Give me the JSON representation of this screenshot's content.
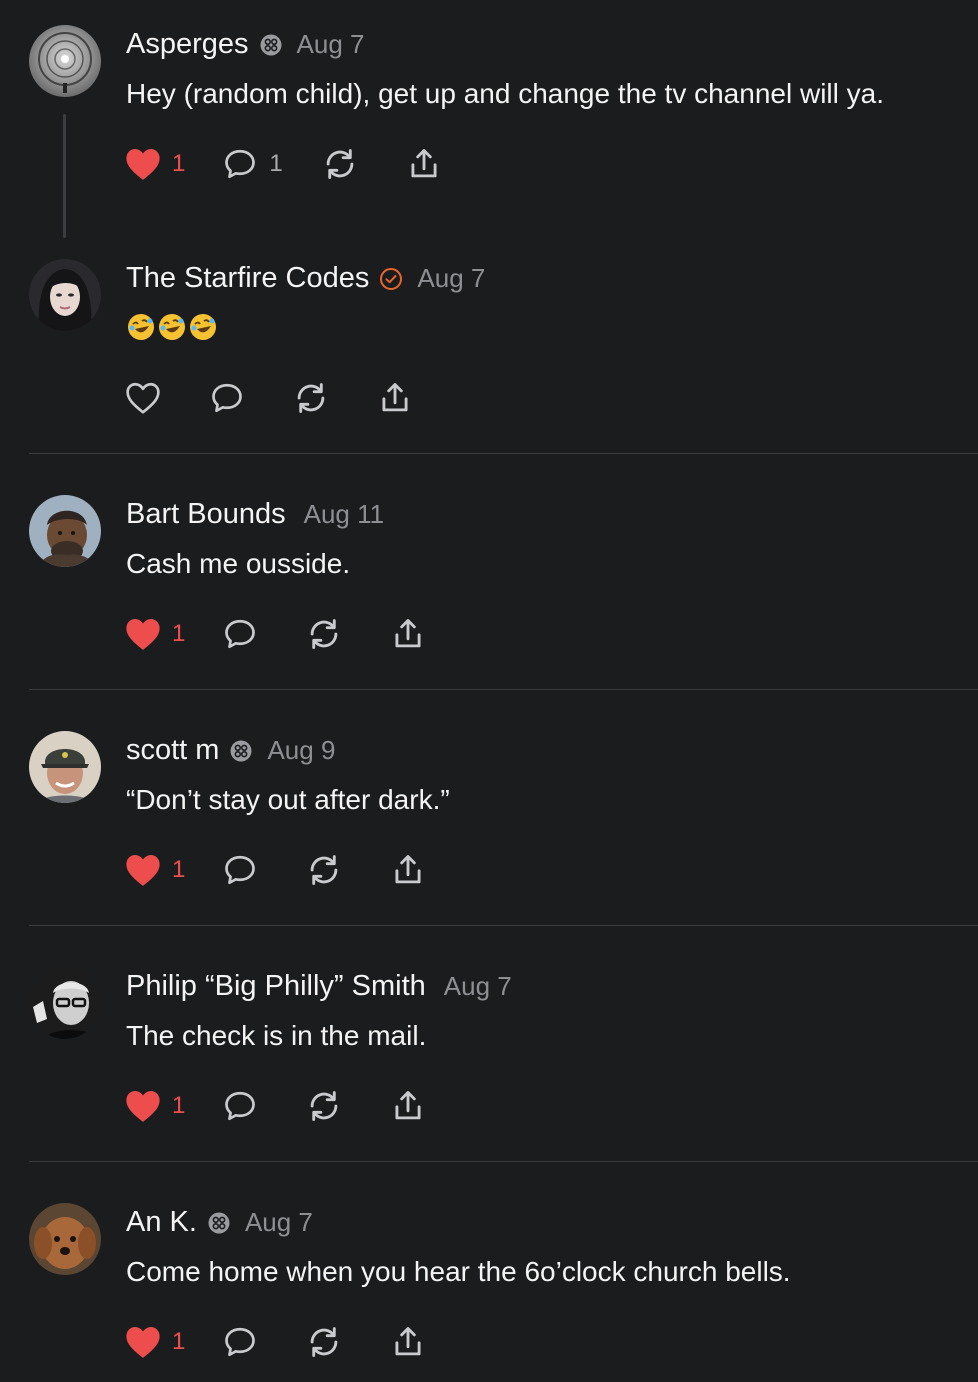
{
  "colors": {
    "background": "#1b1c1e",
    "text": "#f4f4f4",
    "muted": "#8e8f93",
    "like_red": "#ee4d4d",
    "verified_orange": "#e8652d",
    "divider": "#3a3b3e"
  },
  "posts": [
    {
      "name": "Asperges",
      "badge": "subscriber-badge-icon",
      "date": "Aug 7",
      "text": "Hey (random child), get up and change the tv channel will ya.",
      "liked": true,
      "like_count": "1",
      "reply_count": "1"
    },
    {
      "name": "The Starfire Codes",
      "badge": "verified-check-icon",
      "date": "Aug 7",
      "text": "🤣🤣🤣",
      "liked": false,
      "like_count": "",
      "reply_count": ""
    },
    {
      "name": "Bart Bounds",
      "badge": "",
      "date": "Aug 11",
      "text": "Cash me ousside.",
      "liked": true,
      "like_count": "1",
      "reply_count": ""
    },
    {
      "name": "scott m",
      "badge": "subscriber-badge-icon",
      "date": "Aug 9",
      "text": "“Don’t stay out after dark.”",
      "liked": true,
      "like_count": "1",
      "reply_count": ""
    },
    {
      "name": "Philip “Big Philly” Smith",
      "badge": "",
      "date": "Aug 7",
      "text": "The check is in the mail.",
      "liked": true,
      "like_count": "1",
      "reply_count": ""
    },
    {
      "name": "An K.",
      "badge": "subscriber-badge-icon",
      "date": "Aug 7",
      "text": "Come home when you hear the 6o’clock church bells.",
      "liked": true,
      "like_count": "1",
      "reply_count": ""
    }
  ]
}
